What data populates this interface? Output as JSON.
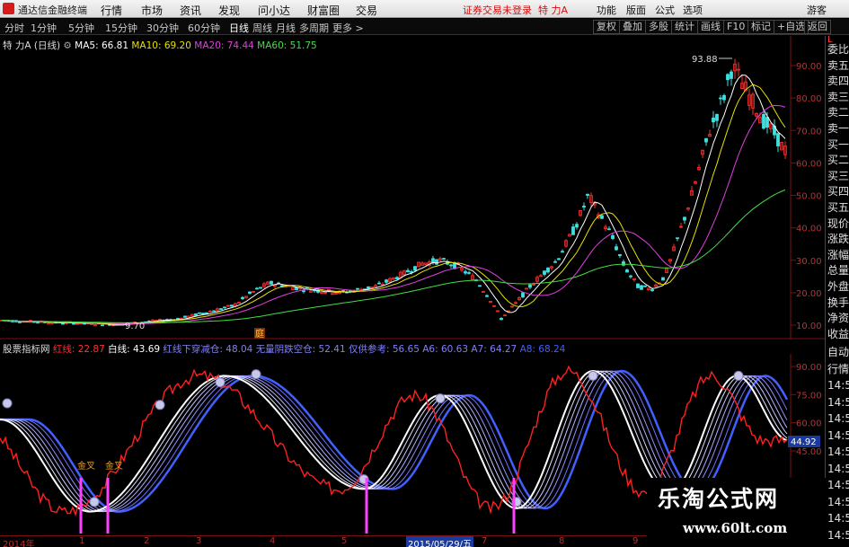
{
  "menubar": {
    "app_title": "通达信金融终端",
    "menu": [
      "行情",
      "市场",
      "资讯",
      "发现",
      "问小达",
      "财富圈",
      "交易"
    ],
    "login_status": "证券交易未登录",
    "stock_name": "特 力A",
    "right_menu": [
      "功能",
      "版面",
      "公式",
      "选项",
      "游客"
    ]
  },
  "toolbar": {
    "periods": [
      "分时",
      "1分钟",
      "5分钟",
      "15分钟",
      "30分钟",
      "60分钟",
      "日线",
      "周线",
      "月线",
      "多周期",
      "更多 >"
    ],
    "active_period": "日线",
    "buttons": [
      "复权",
      "叠加",
      "多股",
      "统计",
      "画线",
      "F10",
      "标记",
      "+自选",
      "返回"
    ]
  },
  "main_chart": {
    "title": "特 力A (日线)",
    "ma": [
      {
        "label": "MA5: 66.81",
        "color": "#ffffff"
      },
      {
        "label": "MA10: 69.20",
        "color": "#e8e000"
      },
      {
        "label": "MA20: 74.44",
        "color": "#e040e0"
      },
      {
        "label": "MA60: 51.75",
        "color": "#40e040"
      }
    ],
    "y_ticks": [
      "90.00",
      "80.00",
      "70.00",
      "60.00",
      "50.00",
      "40.00",
      "30.00",
      "20.00",
      "10.00"
    ],
    "high_label": "93.88",
    "low_label": "9.70",
    "event_marker": "庭"
  },
  "indicator_chart": {
    "name": "股票指标网",
    "values": [
      {
        "label": "红线: 22.87",
        "color": "#ff3030"
      },
      {
        "label": "白线: 43.69",
        "color": "#ffffff"
      },
      {
        "label": "红线下穿减仓: 48.04",
        "color": "#8080ff"
      },
      {
        "label": "无量阴跌空仓: 52.41",
        "color": "#8080ff"
      },
      {
        "label": "仅供参考: 56.65",
        "color": "#8080ff"
      },
      {
        "label": "A6: 60.63",
        "color": "#8080ff"
      },
      {
        "label": "A7: 64.27",
        "color": "#8080ff"
      },
      {
        "label": "A8: 68.24",
        "color": "#4060ff"
      }
    ],
    "y_ticks": [
      "90.00",
      "75.00",
      "60.00",
      "45.00"
    ],
    "current_value": "44.92",
    "markers": [
      "金叉",
      "金叉"
    ]
  },
  "side_panel": {
    "header_L": "L",
    "items_top": [
      "委比",
      "卖五",
      "卖四",
      "卖三",
      "卖二",
      "卖一",
      "买一",
      "买二",
      "买三",
      "买四",
      "买五",
      "现价",
      "涨跌",
      "涨幅",
      "总量",
      "外盘",
      "换手",
      "净资",
      "收益"
    ],
    "items_bottom": [
      "自动",
      "行情",
      "14:5",
      "14:5",
      "14:5",
      "14:5",
      "14:5",
      "14:5",
      "14:5",
      "14:5",
      "14:5",
      "14:5"
    ]
  },
  "x_axis": {
    "labels": [
      "2014年",
      "1",
      "2",
      "3",
      "4",
      "5",
      "7",
      "8",
      "9"
    ],
    "cursor_date": "2015/05/29/五"
  },
  "watermark": {
    "title": "乐淘公式网",
    "url": "www.60lt.com"
  },
  "colors": {
    "up": "#ff3030",
    "down": "#40e0e0",
    "ma5": "#ffffff",
    "ma10": "#e8e000",
    "ma20": "#e040e0",
    "ma60": "#40e040",
    "axis_border": "#7a1010"
  }
}
